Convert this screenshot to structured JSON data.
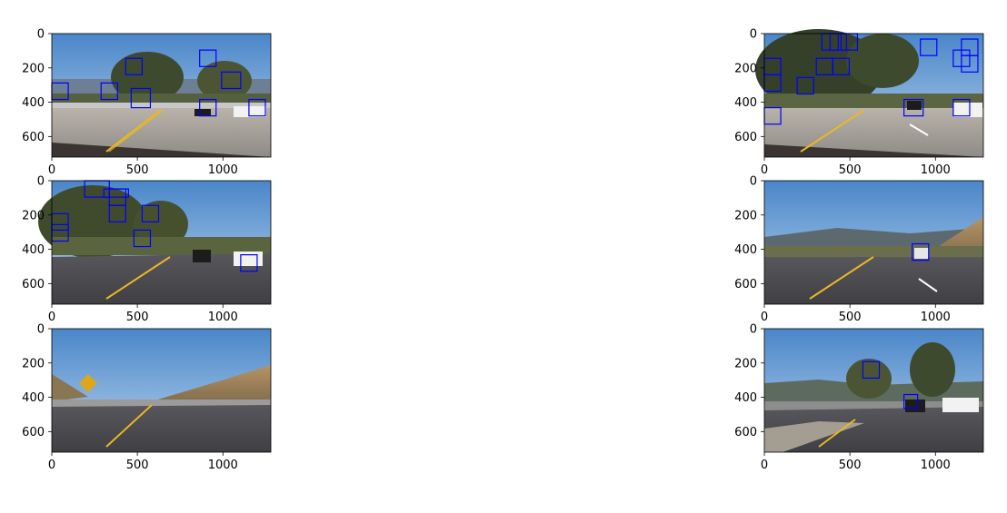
{
  "figure": {
    "layout": {
      "rows": 3,
      "cols": 2
    },
    "x_ticks": [
      0,
      500,
      1000
    ],
    "y_ticks": [
      0,
      200,
      400,
      600
    ],
    "x_range": [
      0,
      1280
    ],
    "y_range": [
      0,
      720
    ],
    "y_inverted": true,
    "box_color": "#0000ff",
    "axis_color": "#000000"
  },
  "chart_data": [
    {
      "type": "image-with-detection-boxes",
      "scene": "road-1",
      "boxes": [
        [
          0,
          288,
          96,
          384
        ],
        [
          288,
          288,
          384,
          384
        ],
        [
          432,
          144,
          528,
          240
        ],
        [
          464,
          320,
          576,
          432
        ],
        [
          864,
          96,
          960,
          192
        ],
        [
          864,
          384,
          960,
          480
        ],
        [
          992,
          224,
          1104,
          320
        ],
        [
          1152,
          384,
          1248,
          480
        ]
      ]
    },
    {
      "type": "image-with-detection-boxes",
      "scene": "road-2",
      "boxes": [
        [
          0,
          144,
          96,
          240
        ],
        [
          0,
          240,
          96,
          336
        ],
        [
          0,
          432,
          96,
          528
        ],
        [
          192,
          256,
          288,
          352
        ],
        [
          304,
          144,
          400,
          240
        ],
        [
          336,
          0,
          432,
          96
        ],
        [
          384,
          0,
          480,
          96
        ],
        [
          400,
          144,
          496,
          240
        ],
        [
          448,
          0,
          544,
          96
        ],
        [
          816,
          384,
          928,
          480
        ],
        [
          912,
          32,
          1008,
          128
        ],
        [
          1104,
          96,
          1200,
          192
        ],
        [
          1104,
          384,
          1200,
          480
        ],
        [
          1152,
          32,
          1248,
          128
        ],
        [
          1152,
          128,
          1248,
          224
        ]
      ]
    },
    {
      "type": "image-with-detection-boxes",
      "scene": "road-3",
      "boxes": [
        [
          0,
          192,
          96,
          288
        ],
        [
          0,
          256,
          96,
          352
        ],
        [
          192,
          0,
          336,
          96
        ],
        [
          304,
          48,
          448,
          96
        ],
        [
          336,
          48,
          432,
          144
        ],
        [
          336,
          144,
          432,
          240
        ],
        [
          528,
          144,
          624,
          240
        ],
        [
          480,
          288,
          576,
          384
        ],
        [
          1104,
          432,
          1200,
          528
        ]
      ]
    },
    {
      "type": "image-with-detection-boxes",
      "scene": "road-4",
      "boxes": [
        [
          864,
          368,
          960,
          464
        ]
      ]
    },
    {
      "type": "image-with-detection-boxes",
      "scene": "road-5",
      "boxes": []
    },
    {
      "type": "image-with-detection-boxes",
      "scene": "road-6",
      "boxes": [
        [
          576,
          192,
          672,
          288
        ],
        [
          816,
          384,
          896,
          464
        ]
      ]
    }
  ]
}
